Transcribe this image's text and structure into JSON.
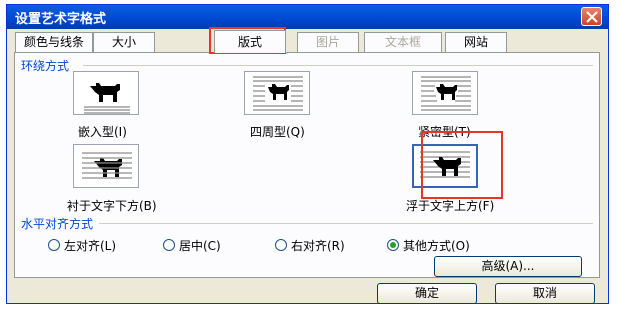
{
  "dialog": {
    "title": "设置艺术字格式",
    "tabs": [
      {
        "label": "颜色与线条",
        "state": "normal"
      },
      {
        "label": "大小",
        "state": "normal"
      },
      {
        "label": "版式",
        "state": "active"
      },
      {
        "label": "图片",
        "state": "disabled"
      },
      {
        "label": "文本框",
        "state": "disabled"
      },
      {
        "label": "网站",
        "state": "normal"
      }
    ]
  },
  "wrapping": {
    "section_label": "环绕方式",
    "options": [
      {
        "label": "嵌入型(I)",
        "icon": "inline-wrap-icon"
      },
      {
        "label": "四周型(Q)",
        "icon": "square-wrap-icon"
      },
      {
        "label": "紧密型(T)",
        "icon": "tight-wrap-icon"
      },
      {
        "label": "衬于文字下方(B)",
        "icon": "behind-text-wrap-icon"
      },
      {
        "label": "浮于文字上方(F)",
        "icon": "in-front-of-text-wrap-icon",
        "selected": true
      }
    ]
  },
  "alignment": {
    "section_label": "水平对齐方式",
    "options": [
      {
        "label": "左对齐(L)",
        "checked": false
      },
      {
        "label": "居中(C)",
        "checked": false
      },
      {
        "label": "右对齐(R)",
        "checked": false
      },
      {
        "label": "其他方式(O)",
        "checked": true
      }
    ],
    "advanced_label": "高级(A)..."
  },
  "footer": {
    "ok_label": "确定",
    "cancel_label": "取消"
  },
  "colors": {
    "title_bar": "#0054e3",
    "dialog_bg": "#ece9d8",
    "group_label": "#0046d5",
    "highlight_box": "#e8352b",
    "radio_selected": "#21a121"
  }
}
